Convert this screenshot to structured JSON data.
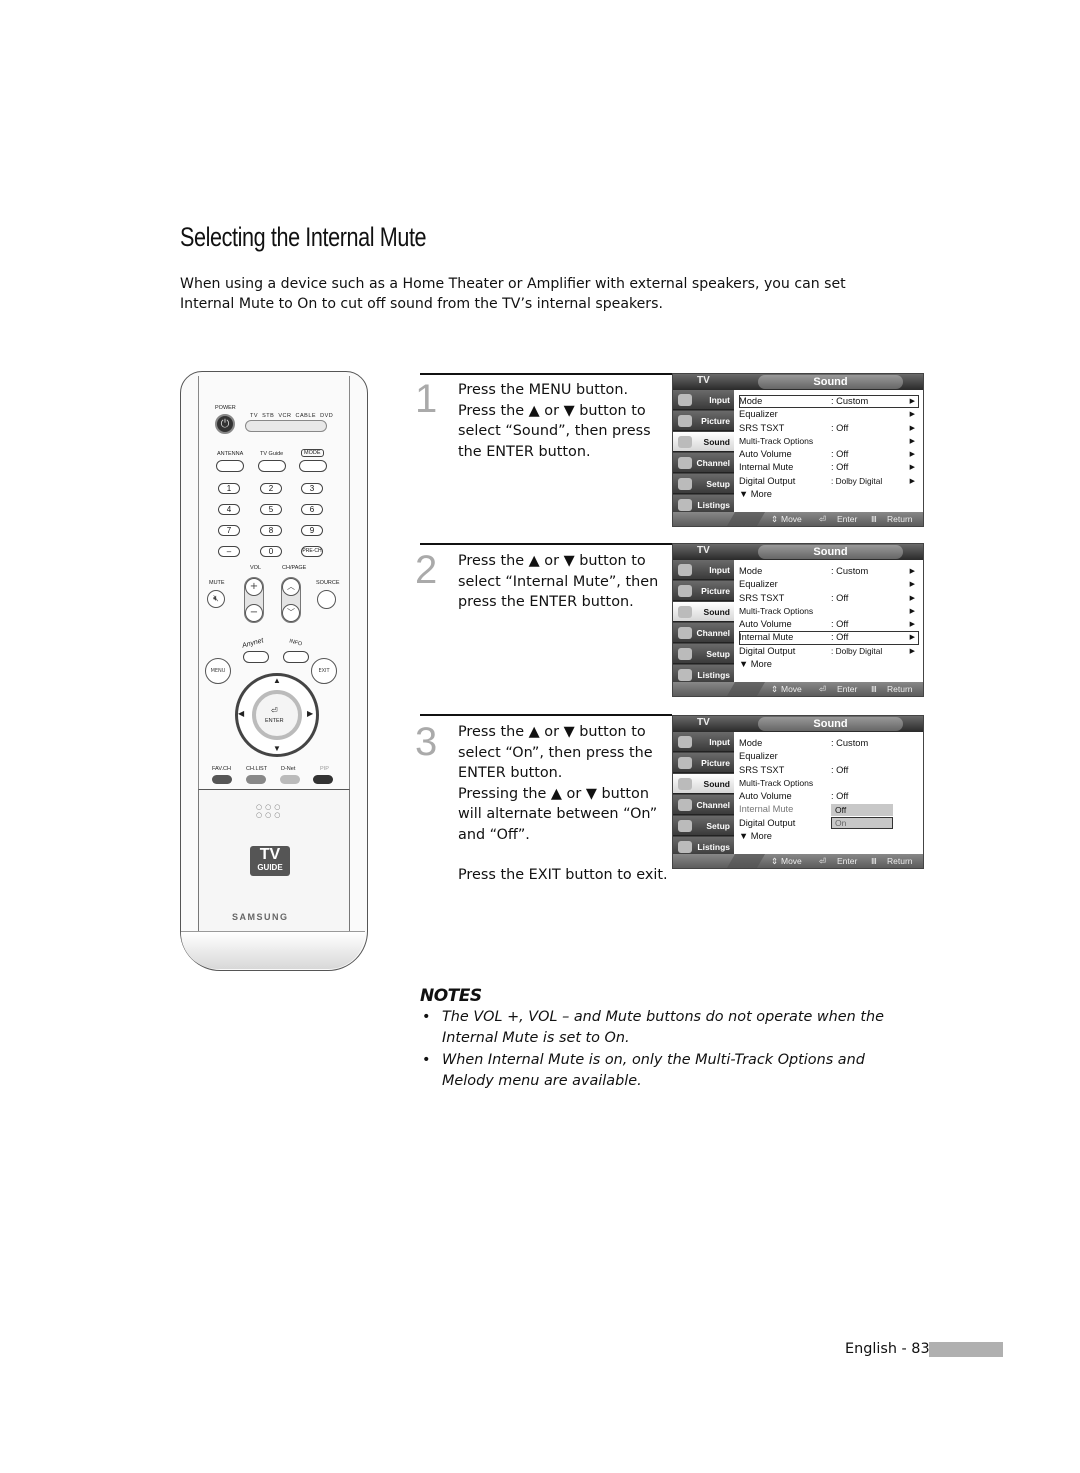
{
  "page": {
    "title": "Selecting the Internal Mute",
    "intro": "When using a device such as a Home Theater or Amplifier with external speakers, you can set Internal Mute to On to cut off sound from the TV’s internal speakers.",
    "footer": "English - 83"
  },
  "remote": {
    "power": "POWER",
    "power_icon": "power-icon",
    "modes": [
      "TV",
      "STB",
      "VCR",
      "CABLE",
      "DVD"
    ],
    "top_buttons": [
      "ANTENNA",
      "TV Guide",
      "MODE"
    ],
    "digits": [
      "1",
      "2",
      "3",
      "4",
      "5",
      "6",
      "7",
      "8",
      "9",
      "–",
      "0",
      "PRE-CH"
    ],
    "vol": "VOL",
    "chpage": "CH/PAGE",
    "mute": "MUTE",
    "source": "SOURCE",
    "anynet": "Anynet",
    "info": "INFO",
    "menu": "MENU",
    "exit": "EXIT",
    "enter": "ENTER",
    "color_buttons": [
      "FAV.CH",
      "CH.LIST",
      "D-Net",
      "PIP"
    ],
    "tvguide_top": "TV",
    "tvguide_bottom": "GUIDE",
    "brand": "SAMSUNG"
  },
  "steps": [
    {
      "number": "1",
      "lines": [
        "Press the MENU button.",
        "Press the ▲ or ▼ button to select “Sound”, then press the ENTER button."
      ]
    },
    {
      "number": "2",
      "lines": [
        "Press the ▲ or ▼ button to select “Internal Mute”, then press the ENTER button."
      ]
    },
    {
      "number": "3",
      "lines": [
        "Press the ▲ or ▼ button to select “On”, then press the ENTER button.",
        "Pressing the ▲ or ▼ button will alternate between “On” and “Off”.",
        "Press the EXIT button to exit."
      ]
    }
  ],
  "osd": {
    "tv_label": "TV",
    "title": "Sound",
    "tabs": [
      "Input",
      "Picture",
      "Sound",
      "Channel",
      "Setup",
      "Listings"
    ],
    "items": [
      {
        "label": "Mode",
        "value": ": Custom"
      },
      {
        "label": "Equalizer",
        "value": ""
      },
      {
        "label": "SRS TSXT",
        "value": ": Off"
      },
      {
        "label": "Multi-Track Options",
        "value": ""
      },
      {
        "label": "Auto Volume",
        "value": ": Off"
      },
      {
        "label": "Internal Mute",
        "value": ": Off"
      },
      {
        "label": "Digital Output",
        "value": ": Dolby Digital"
      },
      {
        "label": "▼ More",
        "value": ""
      }
    ],
    "footer": {
      "move": "Move",
      "enter": "Enter",
      "return": "Return"
    },
    "dropdown_options": [
      "Off",
      "On"
    ],
    "selected_per_screen": [
      "Mode",
      "Internal Mute",
      "On"
    ]
  },
  "notes": {
    "heading": "NOTES",
    "items": [
      "The VOL +, VOL – and Mute buttons do not operate when the Internal Mute is set to On.",
      "When Internal Mute is on, only the Multi-Track Options and Melody menu are available."
    ]
  }
}
